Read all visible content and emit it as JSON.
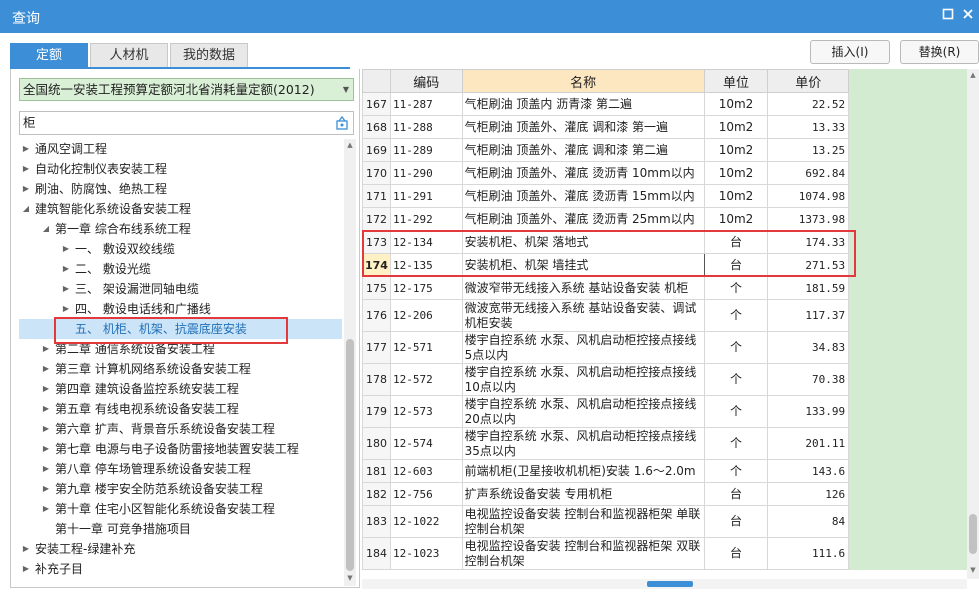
{
  "window": {
    "title": "查询"
  },
  "tabs": [
    {
      "label": "定额"
    },
    {
      "label": "人材机"
    },
    {
      "label": "我的数据"
    }
  ],
  "buttons": {
    "insert": "插入(I)",
    "replace": "替换(R)"
  },
  "library_select": {
    "value": "全国统一安装工程预算定额河北省消耗量定额(2012)"
  },
  "search": {
    "value": "柜"
  },
  "tree": [
    {
      "label": "通风空调工程"
    },
    {
      "label": "自动化控制仪表安装工程"
    },
    {
      "label": "刷油、防腐蚀、绝热工程"
    },
    {
      "label": "建筑智能化系统设备安装工程"
    },
    {
      "label": "第一章 综合布线系统工程"
    },
    {
      "label": "一、 敷设双绞线缆"
    },
    {
      "label": "二、 敷设光缆"
    },
    {
      "label": "三、 架设漏泄同轴电缆"
    },
    {
      "label": "四、 敷设电话线和广播线"
    },
    {
      "label": "五、 机柜、机架、抗震底座安装"
    },
    {
      "label": "第二章 通信系统设备安装工程"
    },
    {
      "label": "第三章 计算机网络系统设备安装工程"
    },
    {
      "label": "第四章 建筑设备监控系统安装工程"
    },
    {
      "label": "第五章 有线电视系统设备安装工程"
    },
    {
      "label": "第六章 扩声、背景音乐系统设备安装工程"
    },
    {
      "label": "第七章 电源与电子设备防雷接地装置安装工程"
    },
    {
      "label": "第八章 停车场管理系统设备安装工程"
    },
    {
      "label": "第九章 楼宇安全防范系统设备安装工程"
    },
    {
      "label": "第十章 住宅小区智能化系统设备安装工程"
    },
    {
      "label": "第十一章 可竞争措施项目"
    },
    {
      "label": "安装工程-绿建补充"
    },
    {
      "label": "补充子目"
    }
  ],
  "table": {
    "headers": {
      "code": "编码",
      "name": "名称",
      "unit": "单位",
      "price": "单价"
    },
    "rows": [
      {
        "num": "167",
        "code": "11-287",
        "name": "气柜刷油 顶盖内 沥青漆 第二遍",
        "unit": "10m2",
        "price": "22.52"
      },
      {
        "num": "168",
        "code": "11-288",
        "name": "气柜刷油 顶盖外、灌底 调和漆 第一遍",
        "unit": "10m2",
        "price": "13.33"
      },
      {
        "num": "169",
        "code": "11-289",
        "name": "气柜刷油 顶盖外、灌底 调和漆 第二遍",
        "unit": "10m2",
        "price": "13.25"
      },
      {
        "num": "170",
        "code": "11-290",
        "name": "气柜刷油 顶盖外、灌底 烫沥青 10mm以内",
        "unit": "10m2",
        "price": "692.84"
      },
      {
        "num": "171",
        "code": "11-291",
        "name": "气柜刷油 顶盖外、灌底 烫沥青 15mm以内",
        "unit": "10m2",
        "price": "1074.98"
      },
      {
        "num": "172",
        "code": "11-292",
        "name": "气柜刷油 顶盖外、灌底 烫沥青 25mm以内",
        "unit": "10m2",
        "price": "1373.98"
      },
      {
        "num": "173",
        "code": "12-134",
        "name": "安装机柜、机架 落地式",
        "unit": "台",
        "price": "174.33"
      },
      {
        "num": "174",
        "code": "12-135",
        "name": "安装机柜、机架 墙挂式",
        "unit": "台",
        "price": "271.53"
      },
      {
        "num": "175",
        "code": "12-175",
        "name": "微波窄带无线接入系统 基站设备安装 机柜",
        "unit": "个",
        "price": "181.59"
      },
      {
        "num": "176",
        "code": "12-206",
        "name": "微波宽带无线接入系统 基站设备安装、调试机柜安装",
        "unit": "个",
        "price": "117.37"
      },
      {
        "num": "177",
        "code": "12-571",
        "name": "楼宇自控系统 水泵、风机启动柜控接点接线 5点以内",
        "unit": "个",
        "price": "34.83"
      },
      {
        "num": "178",
        "code": "12-572",
        "name": "楼宇自控系统 水泵、风机启动柜控接点接线 10点以内",
        "unit": "个",
        "price": "70.38"
      },
      {
        "num": "179",
        "code": "12-573",
        "name": "楼宇自控系统 水泵、风机启动柜控接点接线 20点以内",
        "unit": "个",
        "price": "133.99"
      },
      {
        "num": "180",
        "code": "12-574",
        "name": "楼宇自控系统 水泵、风机启动柜控接点接线 35点以内",
        "unit": "个",
        "price": "201.11"
      },
      {
        "num": "181",
        "code": "12-603",
        "name": "前端机柜(卫星接收机机柜)安装 1.6～2.0m",
        "unit": "个",
        "price": "143.6"
      },
      {
        "num": "182",
        "code": "12-756",
        "name": "扩声系统设备安装 专用机柜",
        "unit": "台",
        "price": "126"
      },
      {
        "num": "183",
        "code": "12-1022",
        "name": "电视监控设备安装 控制台和监视器柜架 单联控制台机架",
        "unit": "台",
        "price": "84"
      },
      {
        "num": "184",
        "code": "12-1023",
        "name": "电视监控设备安装 控制台和监视器柜架 双联控制台机架",
        "unit": "台",
        "price": "111.6"
      }
    ]
  },
  "colors": {
    "titlebar": "#3c8fd7",
    "highlight_box": "#e4393c",
    "select_bg": "#d9efd6"
  }
}
